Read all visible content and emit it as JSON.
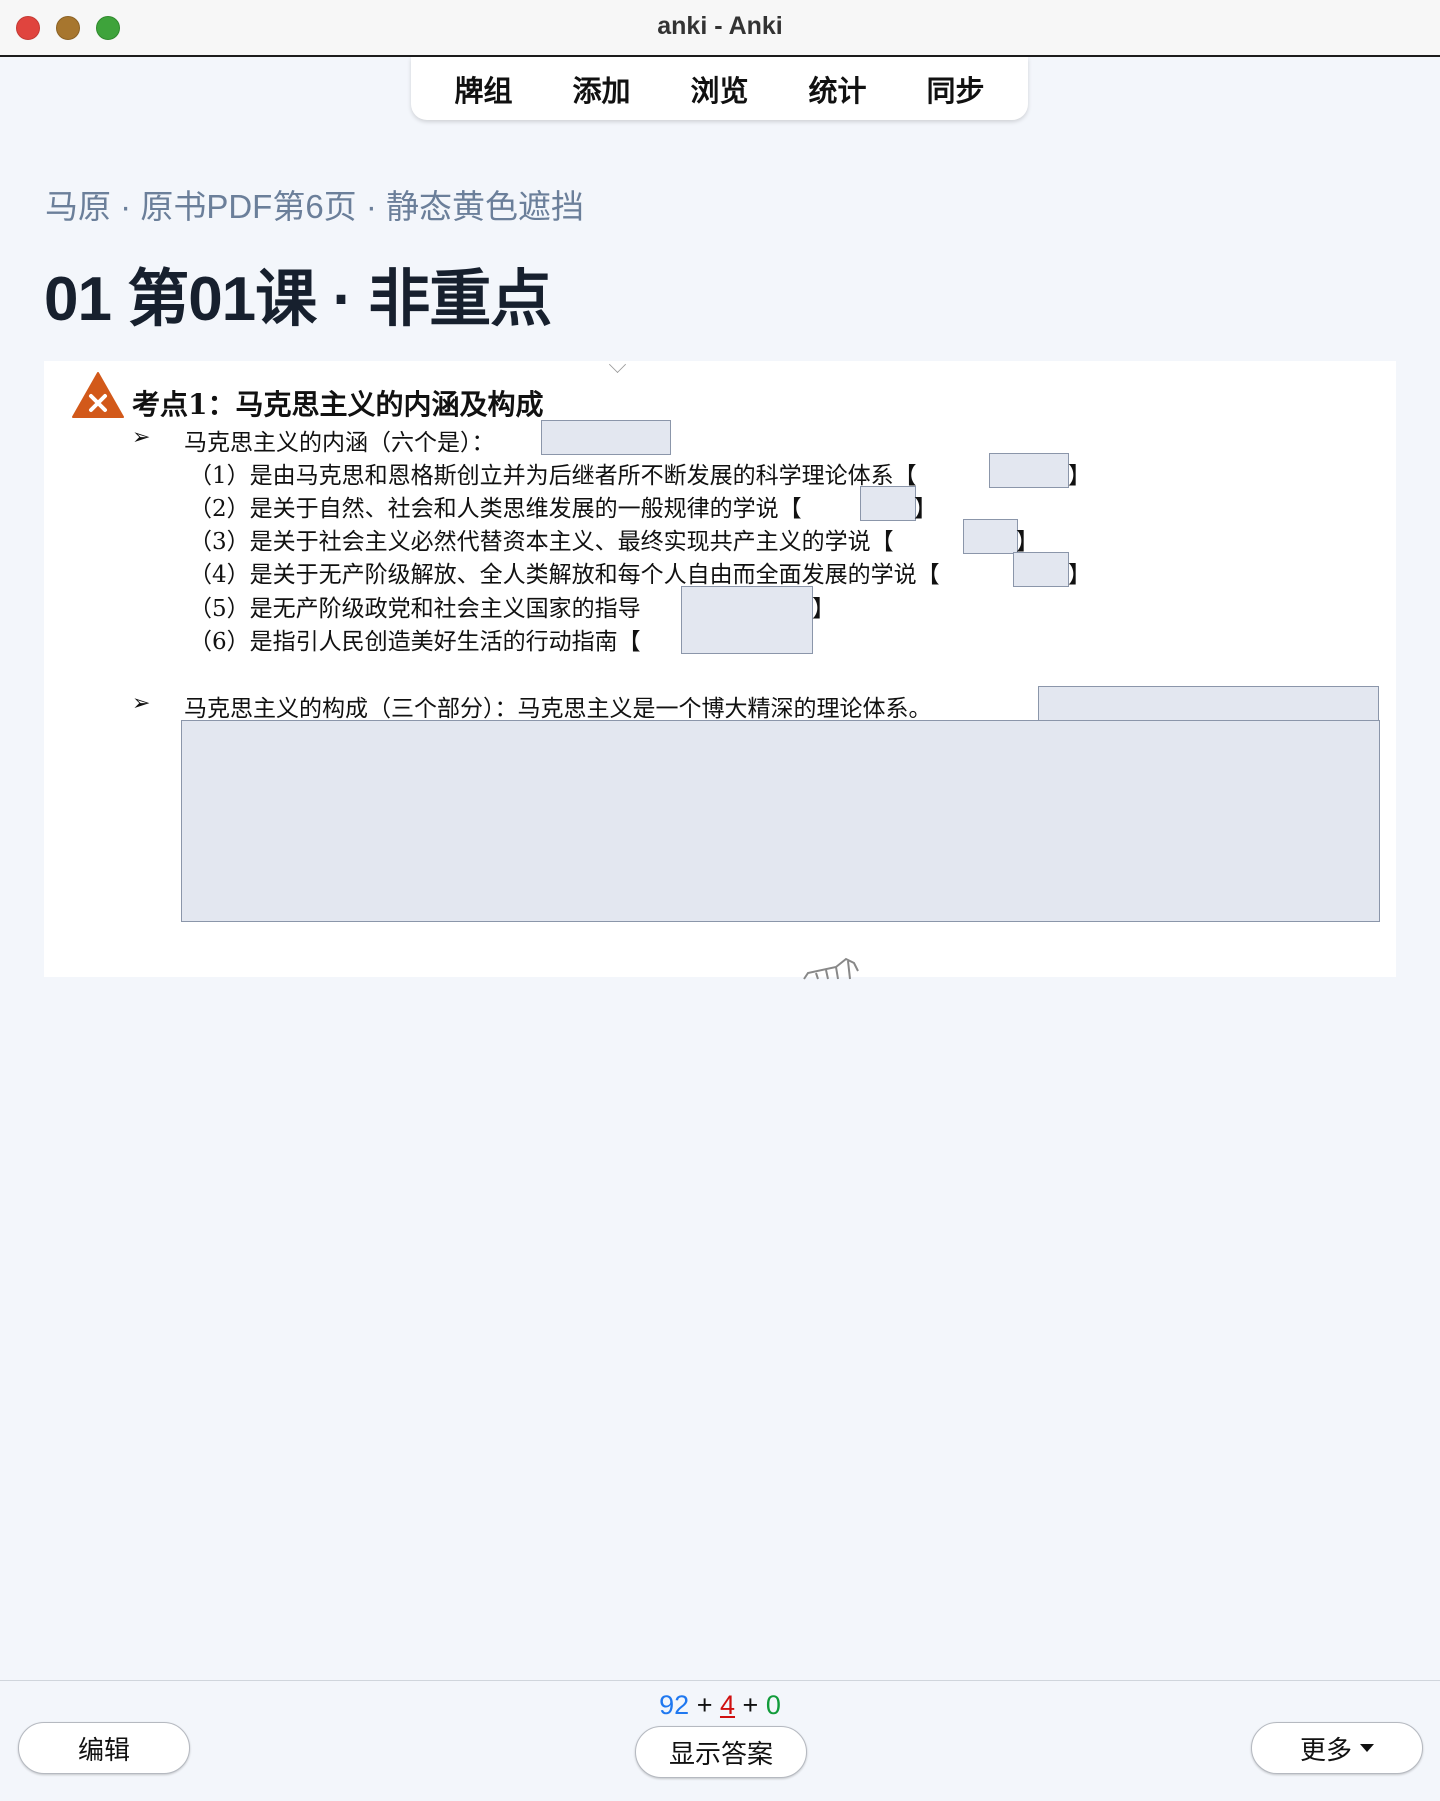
{
  "window": {
    "title": "anki - Anki"
  },
  "toolbar": {
    "items": [
      "牌组",
      "添加",
      "浏览",
      "统计",
      "同步"
    ]
  },
  "deck": {
    "subtitle": "马原 · 原书PDF第6页 · 静态黄色遮挡",
    "heading": "01 第01课 · 非重点"
  },
  "card": {
    "topic": "考点1：马克思主义的内涵及构成",
    "bullet_symbol": "➢",
    "line_intro": "马克思主义的内涵（六个是）：",
    "items": [
      "（1）是由马克思和恩格斯创立并为后继者所不断发展的科学理论体系【",
      "（2）是关于自然、社会和人类思维发展的一般规律的学说【",
      "（3）是关于社会主义必然代替资本主义、最终实现共产主义的学说【",
      "（4）是关于无产阶级解放、全人类解放和每个人自由而全面发展的学说【",
      "（5）是无产阶级政党和社会主义国家的指导",
      "（6）是指引人民创造美好生活的行动指南【"
    ],
    "close_bracket": "】",
    "line_compose": "马克思主义的构成（三个部分）：马克思主义是一个博大精深的理论体系。"
  },
  "footer": {
    "count_new": "92",
    "count_learn": "4",
    "count_review": "0",
    "plus": "+",
    "edit_label": "编辑",
    "show_answer_label": "显示答案",
    "more_label": "更多"
  },
  "colors": {
    "new": "#1f78f0",
    "learn": "#d01010",
    "review": "#119b3a",
    "mask": "#e3e7f0",
    "warning": "#d2591a"
  }
}
